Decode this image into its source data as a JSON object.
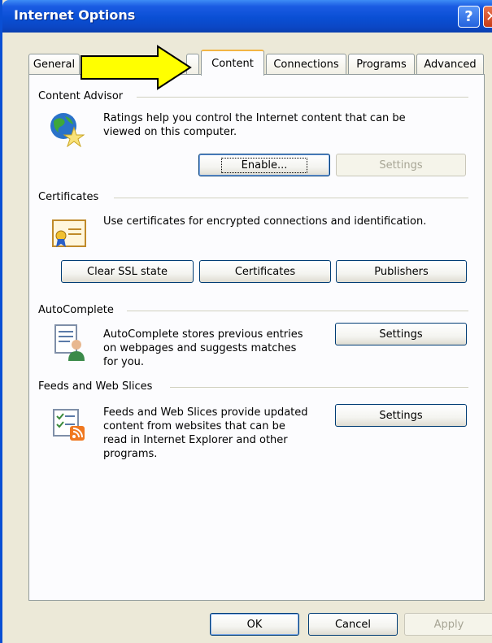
{
  "window": {
    "title": "Internet Options",
    "help_glyph": "?",
    "close_glyph": "✕"
  },
  "tabs": [
    {
      "label": "General"
    },
    {
      "label": "Content",
      "active": true
    },
    {
      "label": "Connections"
    },
    {
      "label": "Programs"
    },
    {
      "label": "Advanced"
    }
  ],
  "content_advisor": {
    "heading": "Content Advisor",
    "description_line1": "Ratings help you control the Internet content that can be",
    "description_line2": "viewed on this computer.",
    "enable_button": "Enable...",
    "settings_button": "Settings",
    "icon": "globe-star-icon"
  },
  "certificates": {
    "heading": "Certificates",
    "description": "Use certificates for encrypted connections and identification.",
    "clear_ssl_button": "Clear SSL state",
    "certificates_button": "Certificates",
    "publishers_button": "Publishers",
    "icon": "certificate-icon"
  },
  "autocomplete": {
    "heading": "AutoComplete",
    "description_line1": "AutoComplete stores previous entries",
    "description_line2": "on webpages and suggests matches",
    "description_line3": "for you.",
    "settings_button": "Settings",
    "icon": "autocomplete-icon"
  },
  "feeds": {
    "heading": "Feeds and Web Slices",
    "description_line1": "Feeds and Web Slices provide updated",
    "description_line2": "content from websites that can be",
    "description_line3": "read in Internet Explorer and other",
    "description_line4": "programs.",
    "settings_button": "Settings",
    "icon": "feeds-icon"
  },
  "footer": {
    "ok_button": "OK",
    "cancel_button": "Cancel",
    "apply_button": "Apply"
  },
  "colors": {
    "title_bar": "#0a4fd4",
    "dialog_bg": "#ece9d8",
    "panel_bg": "#fcfcfe",
    "active_tab_accent": "#f2b544",
    "annotation_arrow": "#ffff00"
  }
}
